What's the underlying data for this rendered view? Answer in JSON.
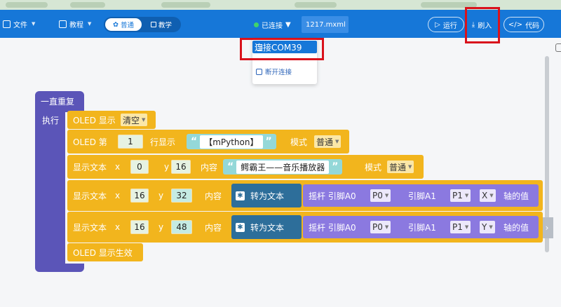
{
  "toolbar": {
    "file_label": "文件",
    "tutorial_label": "教程",
    "mode_normal": "普通",
    "mode_teach": "教学",
    "connection_status": "已连接",
    "filename": "1217.mxml",
    "run_label": "运行",
    "flash_label": "刷入",
    "code_label": "代码"
  },
  "dropdown": {
    "connect_port": "连接COM39",
    "disconnect": "断开连接"
  },
  "blocks": {
    "forever": "一直重复",
    "exec": "执行",
    "oled_show": "OLED 显示",
    "clear": "清空",
    "oled_row_prefix": "OLED 第",
    "row_num": "1",
    "row_show": "行显示",
    "row_text": "【mPython】",
    "mode": "模式",
    "mode_normal": "普通",
    "show_text": "显示文本",
    "x": "x",
    "y": "y",
    "content": "内容",
    "t1_x": "0",
    "t1_y": "16",
    "t1_text": "鳄霸王——音乐播放器",
    "t2_x": "16",
    "t2_y": "32",
    "t3_x": "16",
    "t3_y": "48",
    "to_text": "转为文本",
    "joystick": "摇杆 引脚A0",
    "pin_a1": "引脚A1",
    "p0": "P0",
    "p1": "P1",
    "axis_x": "X",
    "axis_y": "Y",
    "axis_value": "轴的值",
    "oled_apply": "OLED 显示生效"
  },
  "colors": {
    "toolbar": "#1677d8",
    "loop": "#5b55b8",
    "oled_block": "#f2b51d",
    "to_text": "#2d6e9a",
    "joystick": "#8b79e0",
    "highlight": "#d9121c"
  }
}
